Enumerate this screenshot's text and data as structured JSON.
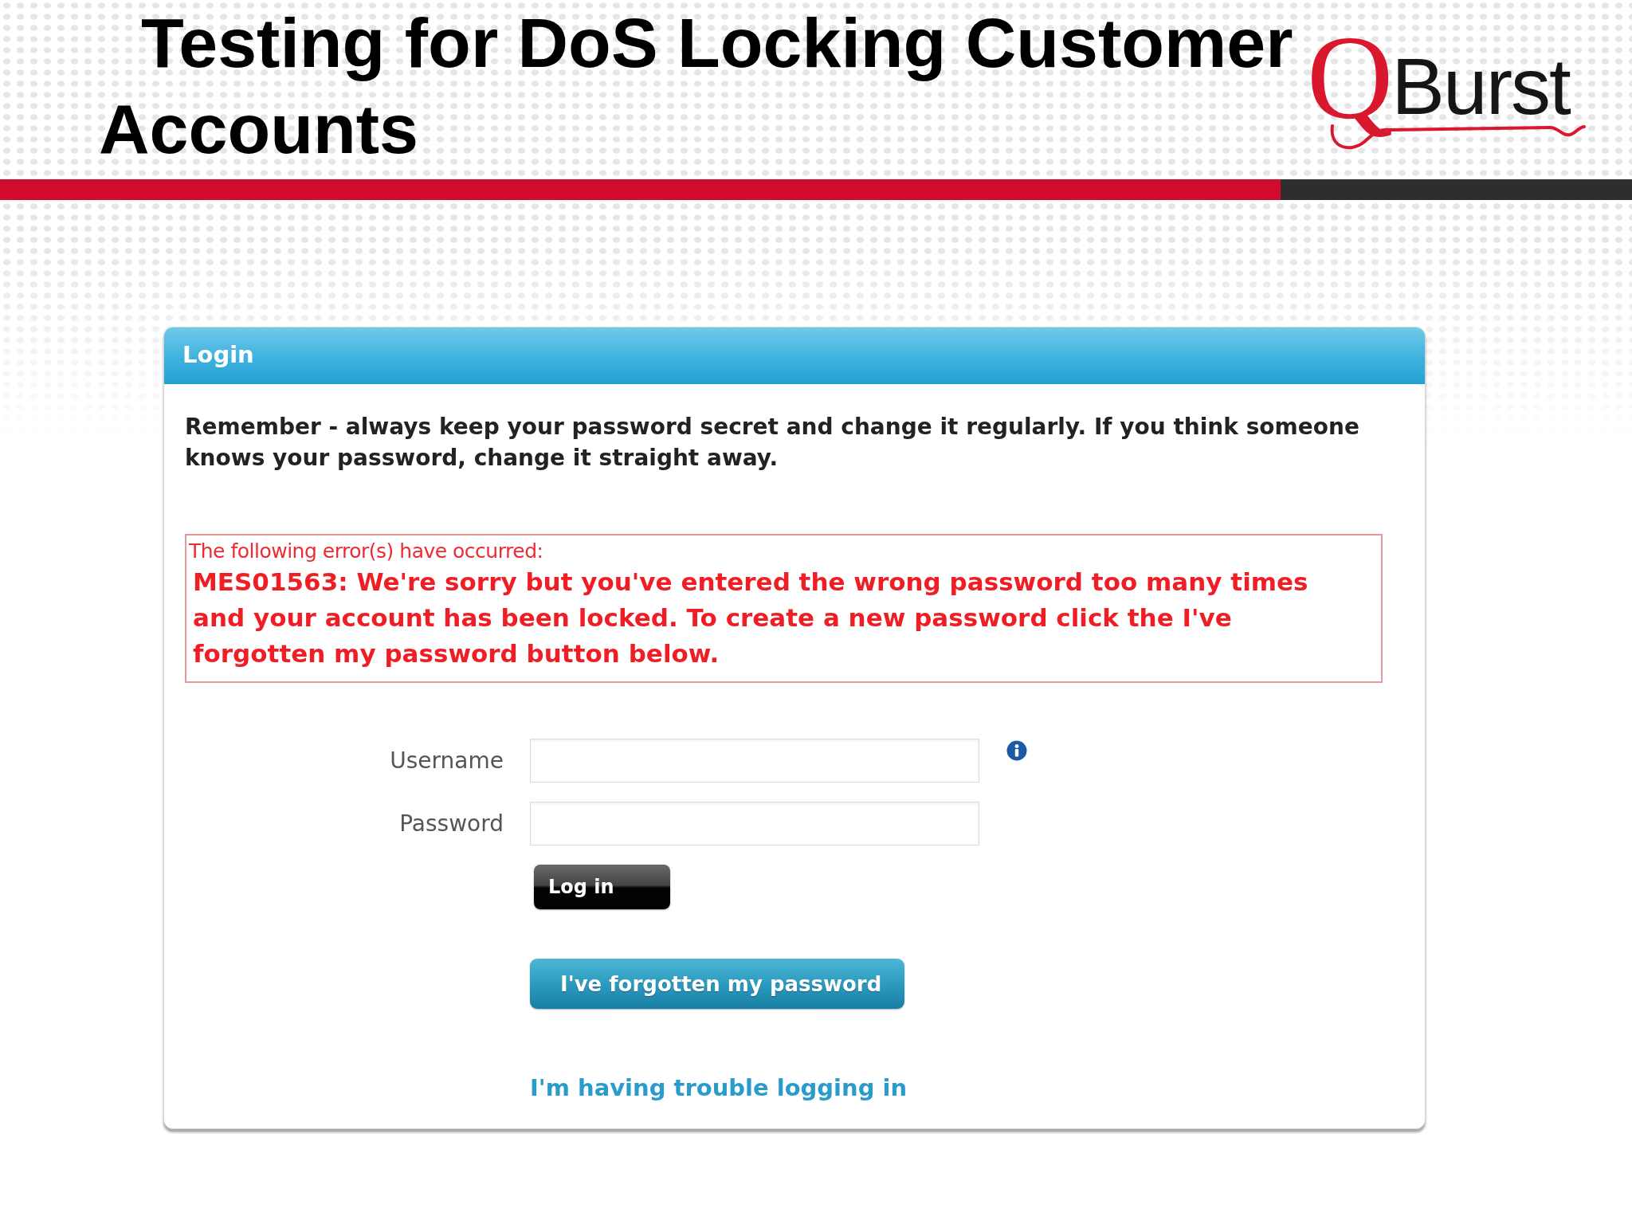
{
  "slide": {
    "title": "Testing for DoS Locking Customer Accounts",
    "logo": {
      "letter": "Q",
      "wordmark": "Burst"
    }
  },
  "panel": {
    "title": "Login",
    "notice": "Remember - always keep your password secret and change it regularly. If you think someone knows your password, change it straight away.",
    "error": {
      "heading": "The following error(s) have occurred:",
      "message": "MES01563: We're sorry but you've entered the wrong password too many times and your account has been locked. To create a new password click the I've forgotten my password button below."
    },
    "fields": [
      {
        "label": "Username",
        "info": true
      },
      {
        "label": "Password",
        "info": false
      }
    ],
    "buttons": [
      {
        "kind": "dark",
        "label": "Log in"
      },
      {
        "kind": "teal",
        "label": "I've forgotten my password"
      }
    ],
    "link": "I'm having trouble logging in"
  }
}
